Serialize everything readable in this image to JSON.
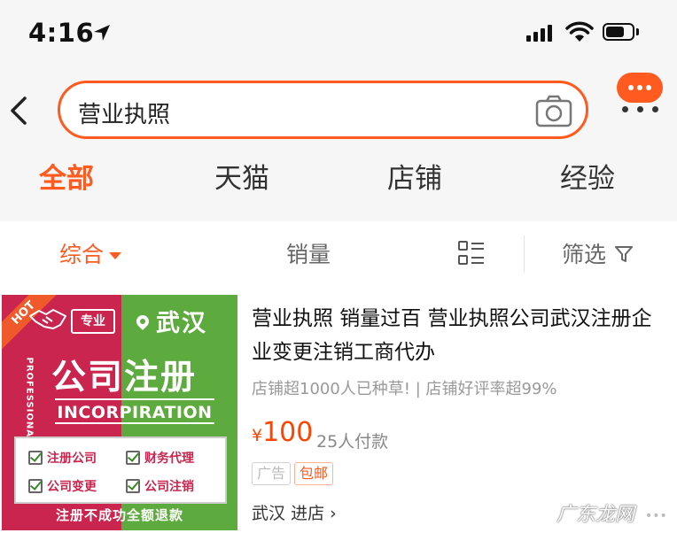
{
  "status_bar": {
    "time": "4:16",
    "battery_level": 0.7
  },
  "search": {
    "query": "营业执照"
  },
  "tabs": [
    {
      "label": "全部",
      "active": true
    },
    {
      "label": "天猫",
      "active": false
    },
    {
      "label": "店铺",
      "active": false
    },
    {
      "label": "经验",
      "active": false
    }
  ],
  "sort": {
    "comprehensive": "综合",
    "sales": "销量",
    "filter": "筛选"
  },
  "product": {
    "image": {
      "hot": "HOT",
      "badge": "专业",
      "city": "武汉",
      "vertical_text": "PROFESSIONAL",
      "title": "公司注册",
      "subtitle": "INCORPIRATION",
      "services": [
        "注册公司",
        "财务代理",
        "公司变更",
        "公司注销"
      ],
      "guarantee": "注册不成功全额退款"
    },
    "title": "营业执照 销量过百 营业执照公司武汉注册企业变更注销工商代办",
    "subtitle": "店铺超1000人已种草! | 店铺好评率超99%",
    "price_symbol": "¥",
    "price": "100",
    "sales": "25人付款",
    "tag_ad": "广告",
    "tag_shipping": "包邮",
    "shop_location": "武汉",
    "shop_link": "进店 ›"
  },
  "watermark": "广东龙网",
  "colors": {
    "accent": "#ff5a1f",
    "price": "#ff4400",
    "image_red": "#c9254e",
    "image_green": "#5daa3e"
  }
}
